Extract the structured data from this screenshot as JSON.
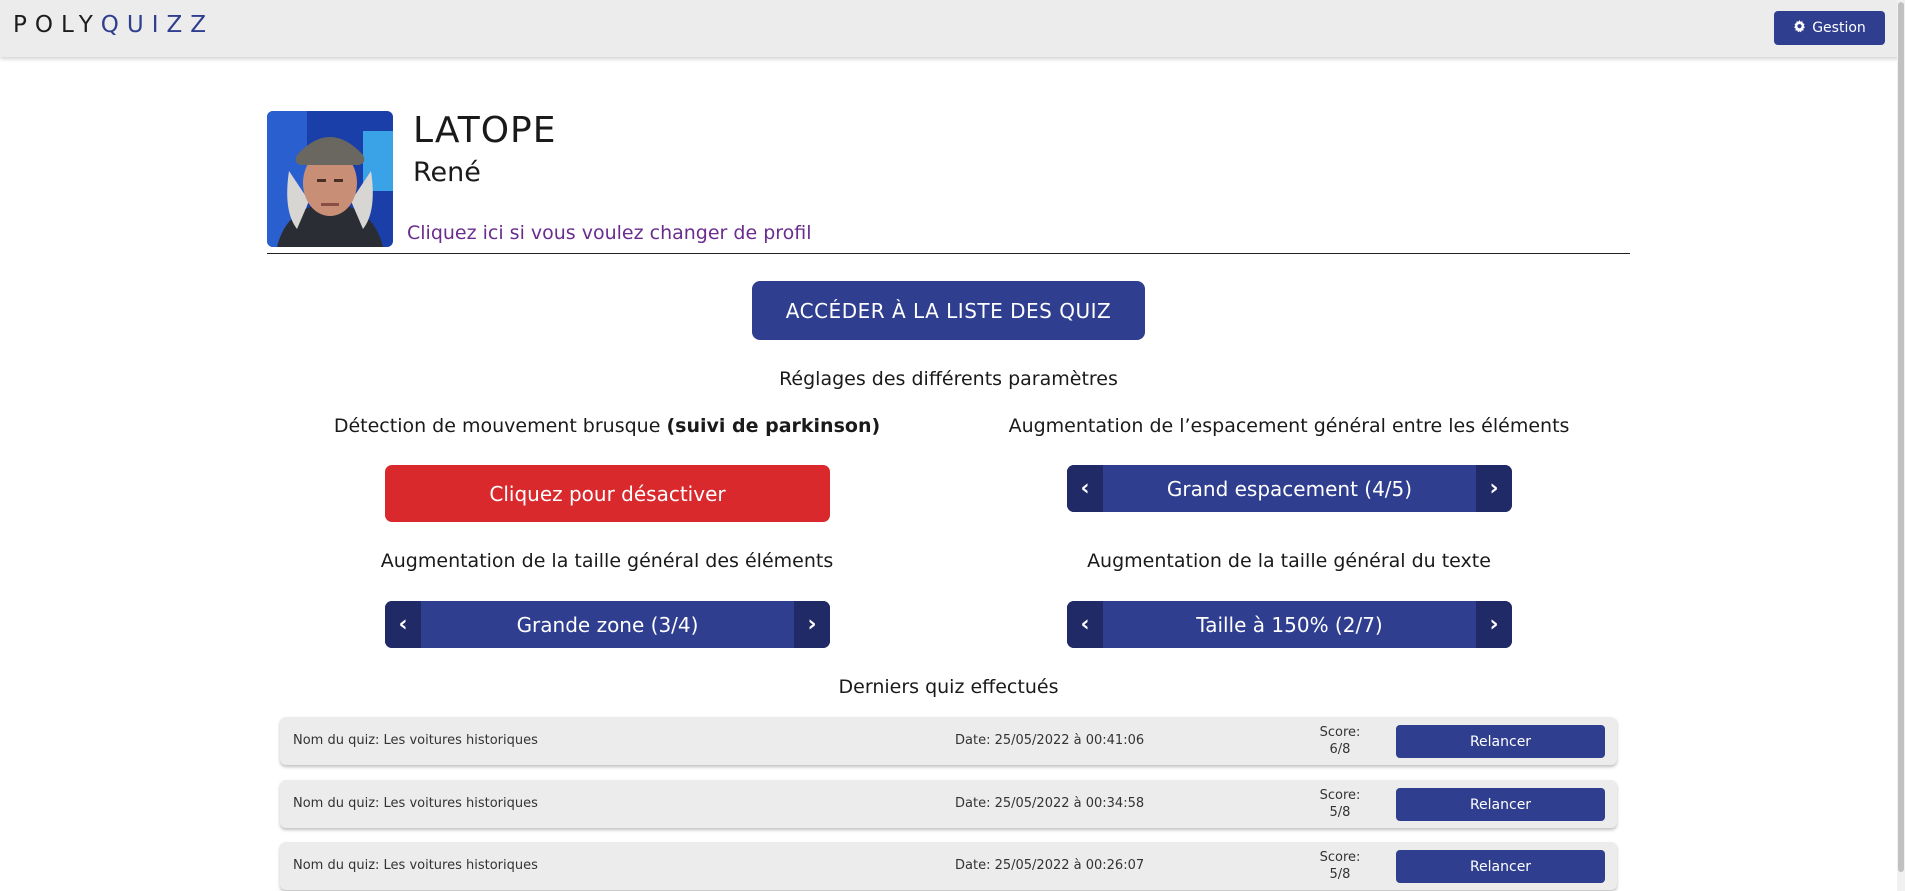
{
  "header": {
    "logo_part1": "POLY",
    "logo_part2": "QUIZZ",
    "gestion_label": "Gestion"
  },
  "profile": {
    "last_name": "LATOPE",
    "first_name": "René",
    "change_profile_link": "Cliquez ici si vous voulez changer de profil"
  },
  "quiz_list_button": "ACCÉDER À LA LISTE DES QUIZ",
  "settings_title": "Réglages des différents paramètres",
  "settings": {
    "movement": {
      "label": "Détection de mouvement brusque",
      "label_bold": "(suivi de parkinson)",
      "button": "Cliquez pour désactiver"
    },
    "spacing": {
      "label": "Augmentation de l’espacement général entre les éléments",
      "value": "Grand espacement (4/5)"
    },
    "element_size": {
      "label": "Augmentation de la taille général des éléments",
      "value": "Grande zone (3/4)"
    },
    "text_size": {
      "label": "Augmentation de la taille général du texte",
      "value": "Taille à 150% (2/7)"
    }
  },
  "history_title": "Derniers quiz effectués",
  "history": [
    {
      "name": "Nom du quiz: Les voitures historiques",
      "date": "Date: 25/05/2022 à 00:41:06",
      "score_label": "Score:",
      "score": "6/8",
      "action": "Relancer"
    },
    {
      "name": "Nom du quiz: Les voitures historiques",
      "date": "Date: 25/05/2022 à 00:34:58",
      "score_label": "Score:",
      "score": "5/8",
      "action": "Relancer"
    },
    {
      "name": "Nom du quiz: Les voitures historiques",
      "date": "Date: 25/05/2022 à 00:26:07",
      "score_label": "Score:",
      "score": "5/8",
      "action": "Relancer"
    }
  ],
  "colors": {
    "primary": "#2f3e8f",
    "danger": "#d9292c",
    "link": "#6a2c8f"
  }
}
